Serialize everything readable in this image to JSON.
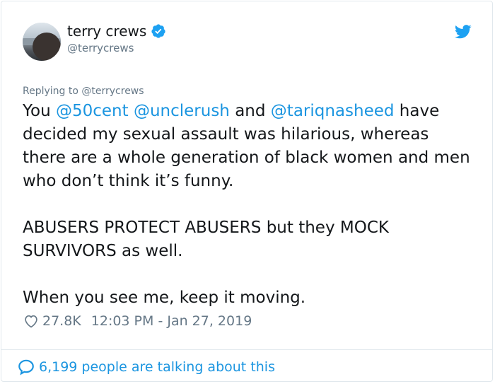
{
  "author": {
    "display_name": "terry crews",
    "handle": "@terrycrews",
    "verified": true
  },
  "reply": {
    "prefix": "Replying to ",
    "target": "@terrycrews"
  },
  "tweet": {
    "line1_pre": "You ",
    "mention1": "@50cent",
    "space1": " ",
    "mention2": "@unclerush",
    "and": " and ",
    "mention3": "@tariqnasheed",
    "line1_post": " have decided my sexual assault was hilarious, whereas there are a whole generation of black women and men who don’t think it’s funny.",
    "para2": "ABUSERS PROTECT ABUSERS but they MOCK SURVIVORS as well.",
    "para3": "When you see me, keep it moving."
  },
  "stats": {
    "likes": "27.8K",
    "timestamp": "12:03 PM - Jan 27, 2019"
  },
  "footer": {
    "talking": "6,199 people are talking about this"
  },
  "colors": {
    "link": "#1b95e0",
    "muted": "#657786",
    "text": "#14171a",
    "verified": "#1da1f2"
  },
  "icons": {
    "verified": "verified-badge-icon",
    "brand": "twitter-bird-icon",
    "like": "heart-icon",
    "replies": "speech-bubble-icon"
  }
}
